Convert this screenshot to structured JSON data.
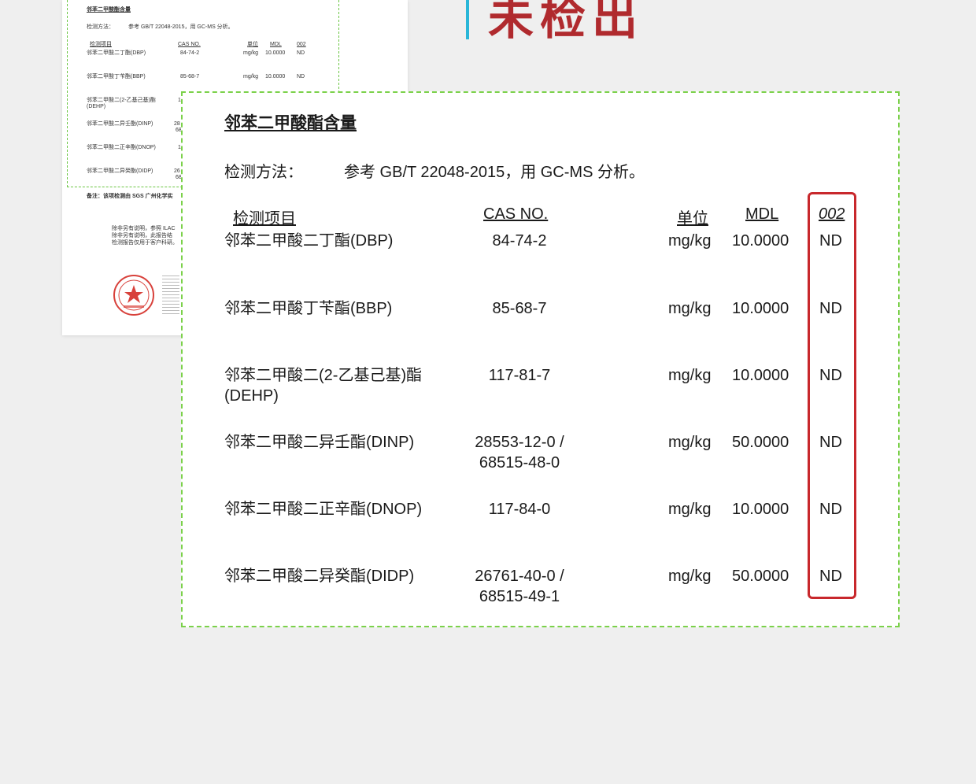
{
  "headline": "未检出",
  "background_page": {
    "title": "邻苯二甲酸酯含量",
    "method_label": "检测方法：",
    "method_value": "参考 GB/T 22048-2015，用 GC-MS 分析。",
    "headers": {
      "item": "检测项目",
      "cas": "CAS NO.",
      "unit": "单位",
      "mdl": "MDL",
      "sample": "002"
    },
    "rows": [
      {
        "name": "邻苯二甲酸二丁酯(DBP)",
        "cas": "84-74-2",
        "unit": "mg/kg",
        "mdl": "10.0000",
        "result": "ND"
      },
      {
        "name": "邻苯二甲酸丁苄酯(BBP)",
        "cas": "85-68-7",
        "unit": "mg/kg",
        "mdl": "10.0000",
        "result": "ND"
      },
      {
        "name": "邻苯二甲酸二(2-乙基己基)酯",
        "name2": "(DEHP)",
        "cas_partial": "1"
      },
      {
        "name": "邻苯二甲酸二异壬酯(DINP)",
        "cas_partial": "28",
        "cas_partial2": "68"
      },
      {
        "name": "邻苯二甲酸二正辛酯(DNOP)",
        "cas_partial": "1"
      },
      {
        "name": "邻苯二甲酸二异癸酯(DIDP)",
        "cas_partial": "26",
        "cas_partial2": "68"
      }
    ],
    "note": "备注：该项检测由 SGS 广州化学实",
    "footer_lines": [
      "除非另有说明，参照 ILAC",
      "除非另有说明，此报告结",
      "检测报告仅用于客户科研。"
    ]
  },
  "card": {
    "title": "邻苯二甲酸酯含量",
    "method_label": "检测方法：",
    "method_value": "参考 GB/T 22048-2015，用 GC-MS 分析。",
    "headers": {
      "item": "检测项目",
      "cas": "CAS NO.",
      "unit": "单位",
      "mdl": "MDL",
      "sample": "002"
    },
    "rows": [
      {
        "name": "邻苯二甲酸二丁酯(DBP)",
        "name2": "",
        "cas": "84-74-2",
        "cas2": "",
        "unit": "mg/kg",
        "mdl": "10.0000",
        "result": "ND"
      },
      {
        "name": "邻苯二甲酸丁苄酯(BBP)",
        "name2": "",
        "cas": "85-68-7",
        "cas2": "",
        "unit": "mg/kg",
        "mdl": "10.0000",
        "result": "ND"
      },
      {
        "name": "邻苯二甲酸二(2-乙基己基)酯",
        "name2": "(DEHP)",
        "cas": "117-81-7",
        "cas2": "",
        "unit": "mg/kg",
        "mdl": "10.0000",
        "result": "ND"
      },
      {
        "name": "邻苯二甲酸二异壬酯(DINP)",
        "name2": "",
        "cas": "28553-12-0 /",
        "cas2": "68515-48-0",
        "unit": "mg/kg",
        "mdl": "50.0000",
        "result": "ND"
      },
      {
        "name": "邻苯二甲酸二正辛酯(DNOP)",
        "name2": "",
        "cas": "117-84-0",
        "cas2": "",
        "unit": "mg/kg",
        "mdl": "10.0000",
        "result": "ND"
      },
      {
        "name": "邻苯二甲酸二异癸酯(DIDP)",
        "name2": "",
        "cas": "26761-40-0 /",
        "cas2": "68515-49-1",
        "unit": "mg/kg",
        "mdl": "50.0000",
        "result": "ND"
      }
    ]
  },
  "colors": {
    "headline": "#b02a2e",
    "accent_bar": "#29b6d8",
    "dashed_border": "#7bd14a",
    "highlight": "#c8282c"
  }
}
